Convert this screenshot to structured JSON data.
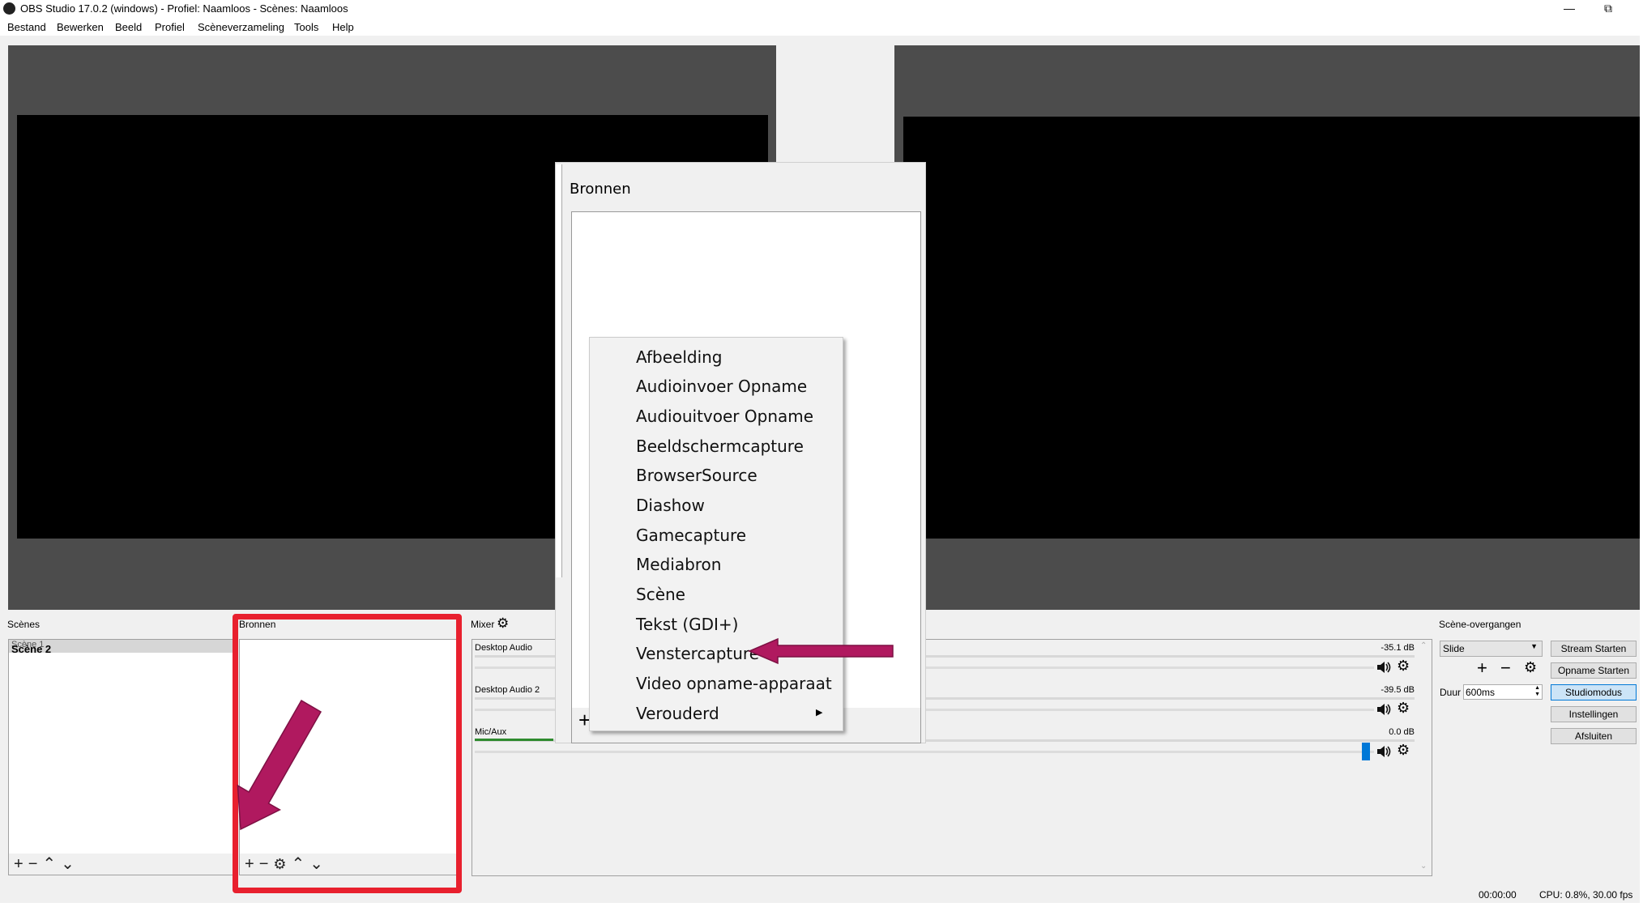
{
  "window": {
    "title": "OBS Studio 17.0.2 (windows) - Profiel: Naamloos - Scènes: Naamloos",
    "minimize_icon": "minimize-icon",
    "restore_icon": "restore-icon"
  },
  "menu": [
    "Bestand",
    "Bewerken",
    "Beeld",
    "Profiel",
    "Scèneverzameling",
    "Tools",
    "Help"
  ],
  "scenes": {
    "label": "Scènes",
    "items": [
      "Scène 1",
      "Scène 2"
    ]
  },
  "sources": {
    "label": "Bronnen"
  },
  "mixer": {
    "label": "Mixer",
    "channels": [
      {
        "name": "Desktop Audio",
        "db": "-35.1 dB"
      },
      {
        "name": "Desktop Audio 2",
        "db": "-39.5 dB"
      },
      {
        "name": "Mic/Aux",
        "db": "0.0 dB"
      }
    ]
  },
  "transitions": {
    "label": "Scène-overgangen",
    "selected": "Slide",
    "duration_label": "Duur",
    "duration_value": "600ms"
  },
  "controls": [
    "Stream Starten",
    "Opname Starten",
    "Studiomodus",
    "Instellingen",
    "Afsluiten"
  ],
  "status": {
    "time": "00:00:00",
    "cpu": "CPU: 0.8%, 30.00 fps"
  },
  "popup": {
    "title": "Bronnen",
    "menu_items": [
      "Afbeelding",
      "Audioinvoer Opname",
      "Audiouitvoer Opname",
      "Beeldschermcapture",
      "BrowserSource",
      "Diashow",
      "Gamecapture",
      "Mediabron",
      "Scène",
      "Tekst (GDI+)",
      "Venstercapture",
      "Video opname-apparaat",
      "Verouderd"
    ]
  },
  "colors": {
    "highlight_box": "#e8202e",
    "annotation_arrow": "#b0195f",
    "active_button": "#cce4f7",
    "mic_level": "#2e8b2e",
    "slider_handle": "#0078d7"
  }
}
